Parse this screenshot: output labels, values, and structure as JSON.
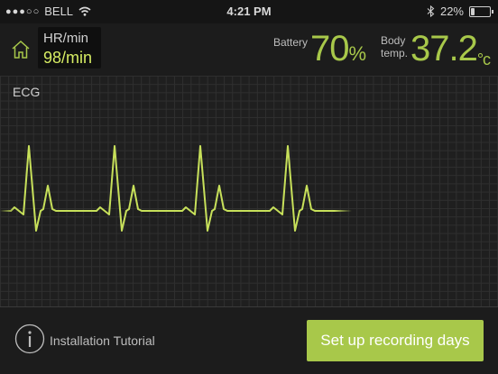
{
  "status_bar": {
    "signal_dots": "●●●○○",
    "carrier": "BELL",
    "time": "4:21 PM",
    "battery_percent": "22%",
    "battery_level": 0.22
  },
  "header": {
    "hr_label": "HR/min",
    "hr_value": "98/min",
    "battery_label": "Battery",
    "battery_value": "70",
    "battery_unit": "%",
    "temp_label_line1": "Body",
    "temp_label_line2": "temp.",
    "temp_value": "37.2",
    "temp_unit": "°c"
  },
  "ecg": {
    "label": "ECG",
    "trace_color": "#c7e05a"
  },
  "footer": {
    "tutorial_label": "Installation Tutorial",
    "setup_button_label": "Set up recording days"
  },
  "colors": {
    "accent": "#a8c84a",
    "background": "#1c1c1c"
  }
}
